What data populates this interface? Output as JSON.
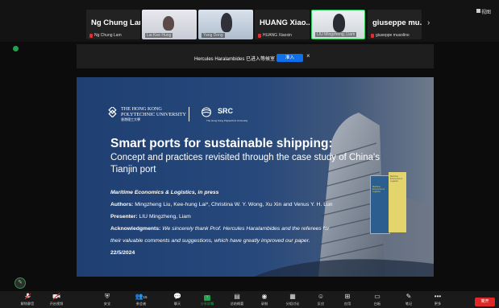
{
  "participants_strip": {
    "tiles": [
      {
        "big_name": "Ng Chung Lam",
        "label": "Ng Chung Lam"
      },
      {
        "label": "Lai Kee Hung"
      },
      {
        "label": "Yang Dong"
      },
      {
        "big_name": "HUANG Xiao...",
        "label": "HUANG Xiaoxin"
      },
      {
        "label": "LIU Mingzheng, Liam"
      },
      {
        "big_name": "giuseppe mu...",
        "label": "giuseppe musolino"
      }
    ],
    "next_icon": "chevron-right-icon",
    "view_label": "视图"
  },
  "notification": {
    "text": "Hercules Haralambides 已进入等候室",
    "admit_label": "准入",
    "close_icon": "close-icon"
  },
  "slide": {
    "polyu_name": "THE HONG KONG POLYTECHNIC UNIVERSITY",
    "polyu_line1": "THE HONG KONG",
    "polyu_line2": "POLYTECHNIC UNIVERSITY",
    "polyu_cn": "香港理工大學",
    "src_logo": "SRC",
    "src_sub": "The Hong Kong Polytechnic University",
    "title": "Smart ports for sustainable shipping:",
    "subtitle": "Concept and practices revisited through the case study of China's Tianjin port",
    "journal": "Maritime Economics & Logistics, in press",
    "authors_label": "Authors:",
    "authors_value": " Mingzheng Liu, Kee-hung Lai*, Christina W. Y. Wong, Xu Xin and Venus Y. H. Lun",
    "presenter_label": "Presenter:",
    "presenter_value": " LIU Mingzheng, Liam",
    "ack_label": "Acknowledgments:",
    "ack_line1": " We sincerely thank Prof. Hercules Haralambides and the referees for",
    "ack_line2": "their valuable comments and suggestions, which have greatly improved our paper.",
    "date": "22/5/2024",
    "book1_text": "Maritime Economics & Logistics",
    "book2_text": "Maritime Economics & Logistics"
  },
  "toolbar": {
    "items": [
      {
        "icon": "microphone-icon",
        "label": "解除静音"
      },
      {
        "icon": "video-camera-icon",
        "label": "开启视频"
      },
      {
        "icon": "shield-icon",
        "label": "安全"
      },
      {
        "icon": "participants-icon",
        "label": "参会者",
        "count": "15"
      },
      {
        "icon": "chat-icon",
        "label": "聊天"
      },
      {
        "icon": "share-screen-icon",
        "label": "分享屏幕"
      },
      {
        "icon": "summary-icon",
        "label": "总结概要"
      },
      {
        "icon": "record-icon",
        "label": "录制"
      },
      {
        "icon": "breakout-rooms-icon",
        "label": "分组讨论"
      },
      {
        "icon": "reactions-icon",
        "label": "反应"
      },
      {
        "icon": "apps-icon",
        "label": "应用"
      },
      {
        "icon": "whiteboard-icon",
        "label": "白板"
      },
      {
        "icon": "notes-icon",
        "label": "笔记"
      },
      {
        "icon": "more-icon",
        "label": "更多"
      }
    ],
    "leave_label": "离开"
  },
  "colors": {
    "accent": "#0e71eb",
    "leave": "#e02828",
    "share_active": "#23a04b"
  }
}
